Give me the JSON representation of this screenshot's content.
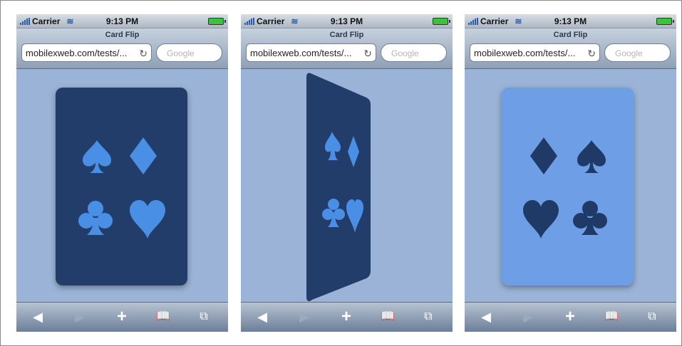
{
  "screens": [
    {
      "status": {
        "carrier": "Carrier",
        "time": "9:13 PM"
      },
      "page_title": "Card Flip",
      "url": "mobilexweb.com/tests/...",
      "search_placeholder": "Google",
      "card_state": "back",
      "card_color": "#223d69",
      "suit_color": "#4a8fe6"
    },
    {
      "status": {
        "carrier": "Carrier",
        "time": "9:13 PM"
      },
      "page_title": "Card Flip",
      "url": "mobilexweb.com/tests/...",
      "search_placeholder": "Google",
      "card_state": "flipping",
      "card_color": "#223d69",
      "suit_color": "#4a8fe6"
    },
    {
      "status": {
        "carrier": "Carrier",
        "time": "9:13 PM"
      },
      "page_title": "Card Flip",
      "url": "mobilexweb.com/tests/...",
      "search_placeholder": "Google",
      "card_state": "front",
      "card_color": "#6e9fe6",
      "suit_color": "#1f3a66"
    }
  ],
  "toolbar_icons": [
    "back-arrow-icon",
    "forward-arrow-icon",
    "add-icon",
    "bookmarks-icon",
    "pages-icon"
  ]
}
